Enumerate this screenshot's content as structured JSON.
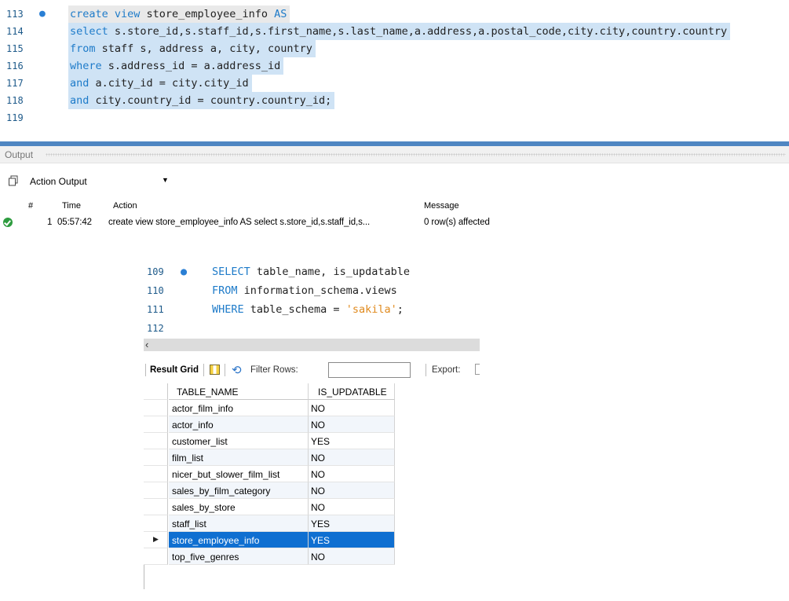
{
  "editor_top": {
    "lines": [
      {
        "num": "113",
        "marker": "●",
        "kw": "create view",
        "rest": " store_employee_info ",
        "kw2": "AS"
      },
      {
        "num": "114",
        "marker": "",
        "kw": "select",
        "rest": " s.store_id,s.staff_id,s.first_name,s.last_name,a.address,a.postal_code,city.city,country.country"
      },
      {
        "num": "115",
        "marker": "",
        "kw": "from",
        "rest": " staff s, address a, city, country"
      },
      {
        "num": "116",
        "marker": "",
        "kw": "where",
        "rest": " s.address_id = a.address_id"
      },
      {
        "num": "117",
        "marker": "",
        "kw": "and",
        "rest": " a.city_id = city.city_id"
      },
      {
        "num": "118",
        "marker": "",
        "kw": "and",
        "rest": " city.country_id = country.country_id;"
      },
      {
        "num": "119",
        "marker": "",
        "kw": "",
        "rest": ""
      }
    ]
  },
  "output": {
    "title": "Output",
    "selector_value": "Action Output",
    "columns": {
      "num": "#",
      "time": "Time",
      "action": "Action",
      "message": "Message"
    },
    "row": {
      "num": "1",
      "time": "05:57:42",
      "action": "create view store_employee_info AS select s.store_id,s.staff_id,s...",
      "message": "0 row(s) affected",
      "status": "success"
    }
  },
  "editor_bottom": {
    "lines": [
      {
        "num": "109",
        "marker": "●",
        "kw": "SELECT",
        "rest": " table_name, is_updatable",
        "str": ""
      },
      {
        "num": "110",
        "marker": "",
        "kw": "FROM",
        "rest": " information_schema.views",
        "str": ""
      },
      {
        "num": "111",
        "marker": "",
        "kw": "WHERE",
        "rest": " table_schema = ",
        "str": "'sakila'",
        "tail": ";"
      },
      {
        "num": "112",
        "marker": "",
        "kw": "",
        "rest": "",
        "str": ""
      }
    ]
  },
  "grid_toolbar": {
    "result_grid_label": "Result Grid",
    "filter_label": "Filter Rows:",
    "filter_value": "",
    "export_label": "Export:"
  },
  "result_grid": {
    "columns": [
      "TABLE_NAME",
      "IS_UPDATABLE"
    ],
    "rows": [
      {
        "table_name": "actor_film_info",
        "is_updatable": "NO"
      },
      {
        "table_name": "actor_info",
        "is_updatable": "NO"
      },
      {
        "table_name": "customer_list",
        "is_updatable": "YES"
      },
      {
        "table_name": "film_list",
        "is_updatable": "NO"
      },
      {
        "table_name": "nicer_but_slower_film_list",
        "is_updatable": "NO"
      },
      {
        "table_name": "sales_by_film_category",
        "is_updatable": "NO"
      },
      {
        "table_name": "sales_by_store",
        "is_updatable": "NO"
      },
      {
        "table_name": "staff_list",
        "is_updatable": "YES"
      },
      {
        "table_name": "store_employee_info",
        "is_updatable": "YES"
      },
      {
        "table_name": "top_five_genres",
        "is_updatable": "NO"
      }
    ],
    "selected_index": 8
  },
  "colors": {
    "keyword": "#1e7bc9",
    "selection": "#0f6fd1",
    "splitter": "#4f86c2",
    "string": "#e08a1e"
  }
}
